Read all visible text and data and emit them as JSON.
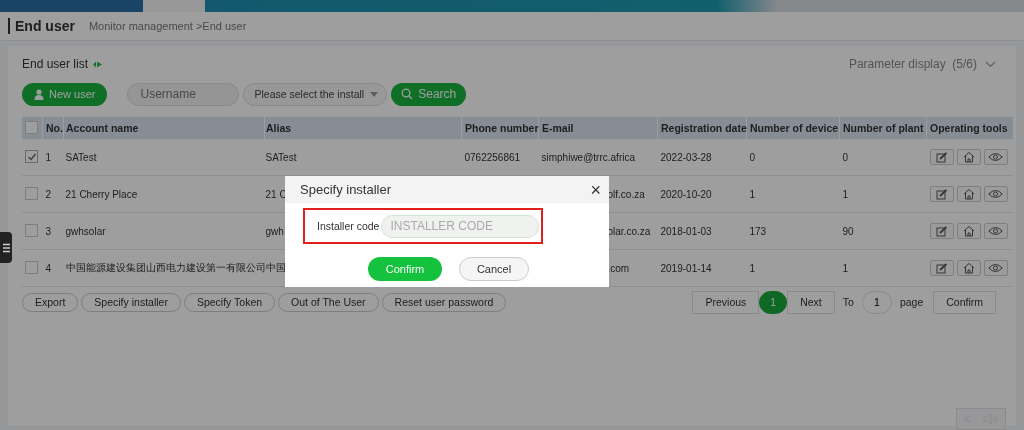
{
  "page": {
    "title": "End user",
    "breadcrumb": "Monitor management >End user"
  },
  "panel": {
    "title": "End user list",
    "parameter_display": "Parameter display",
    "parameter_count": "(5/6)"
  },
  "toolbar": {
    "new_user": "New user",
    "username_placeholder": "Username",
    "installer_select": "Please select the install",
    "search": "Search"
  },
  "table": {
    "columns": [
      "No.",
      "Account name",
      "Alias",
      "Phone number",
      "E-mail",
      "Registration date",
      "Number of device",
      "Number of plant",
      "Operating tools"
    ],
    "all_selected": false,
    "rows": [
      {
        "selected": true,
        "no": "1",
        "account": "SATest",
        "alias": "SATest",
        "phone": "0762256861",
        "email": "simphiwe@trrc.africa",
        "date": "2022-03-28",
        "devices": "0",
        "plants": "0"
      },
      {
        "selected": false,
        "no": "2",
        "account": "21 Cherry Place",
        "alias": "21 C",
        "email": "olf.co.za",
        "date": "2020-10-20",
        "devices": "1",
        "plants": "1"
      },
      {
        "selected": false,
        "no": "3",
        "account": "gwhsolar",
        "alias": "gwh",
        "email": "olar.co.za",
        "date": "2018-01-03",
        "devices": "173",
        "plants": "90"
      },
      {
        "selected": false,
        "no": "4",
        "account": "中国能源建设集团山西电力建设第一有限公司",
        "alias": "中国",
        "email": ".com",
        "date": "2019-01-14",
        "devices": "1",
        "plants": "1"
      }
    ]
  },
  "actions": [
    "Export",
    "Specify installer",
    "Specify Token",
    "Out of The User",
    "Reset user password"
  ],
  "pagination": {
    "previous": "Previous",
    "pages": [
      {
        "label": "1",
        "selected": true
      }
    ],
    "next": "Next",
    "to": "To",
    "page_value": "1",
    "page": "page",
    "confirm": "Confirm"
  },
  "dialog": {
    "title": "Specify installer",
    "close": "×",
    "field_label": "Installer code",
    "placeholder": "INSTALLER CODE",
    "confirm": "Confirm",
    "cancel": "Cancel"
  }
}
